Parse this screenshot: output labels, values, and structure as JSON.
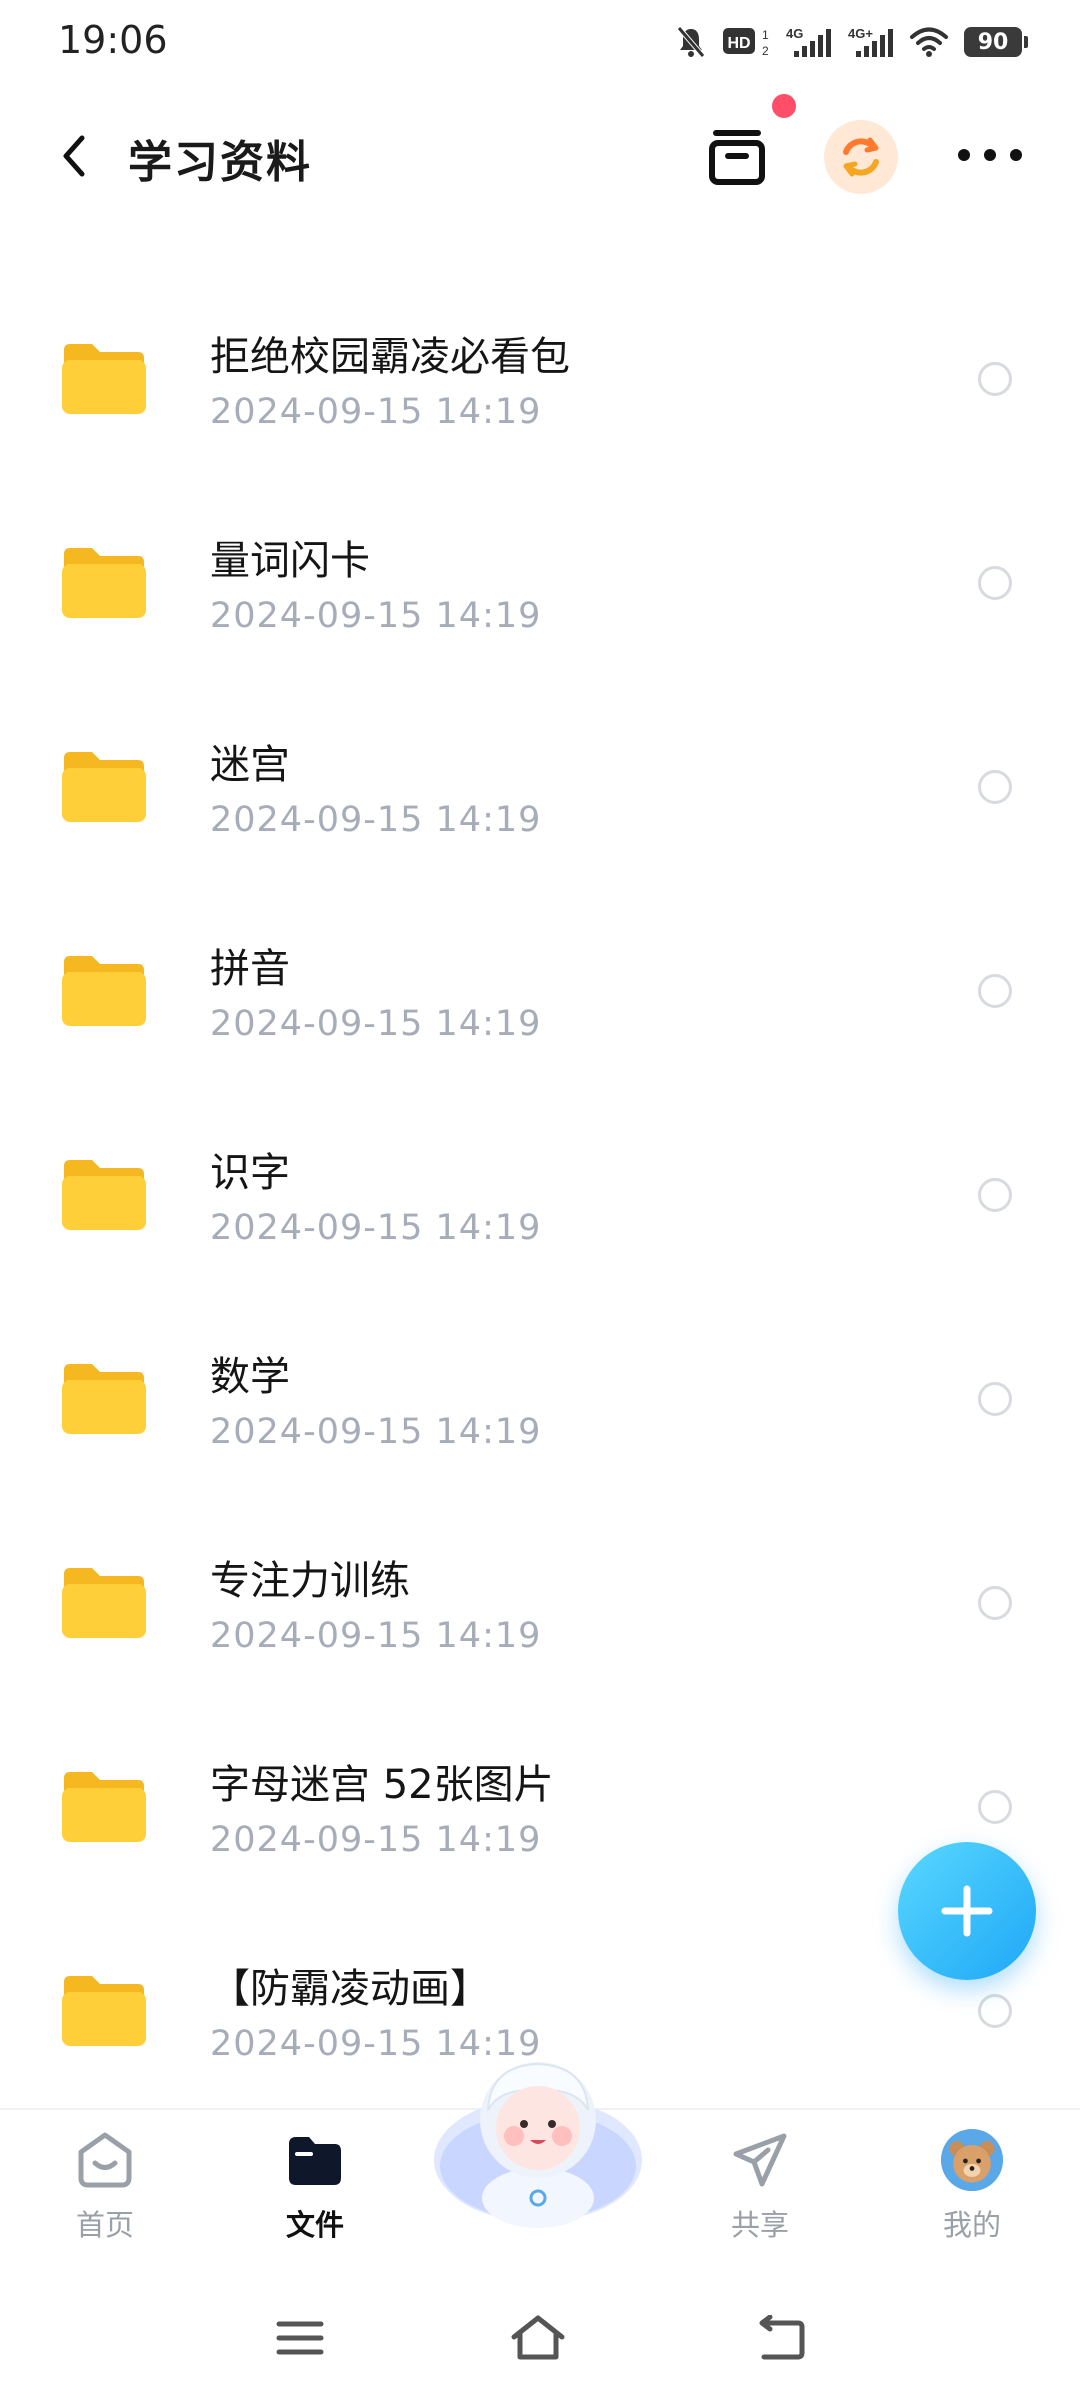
{
  "status_bar": {
    "time": "19:06",
    "battery": "90",
    "icons": [
      "mute-bell-icon",
      "hd-icon",
      "signal-4g-icon",
      "signal-4g-plus-icon",
      "wifi-icon",
      "battery-icon"
    ]
  },
  "header": {
    "title": "学习资料",
    "icons": [
      "back-icon",
      "archive-icon",
      "sync-icon",
      "more-icon"
    ],
    "notification_color": "#ff4d6a"
  },
  "files": [
    {
      "name": "拒绝校园霸凌必看包",
      "date": "2024-09-15  14:19"
    },
    {
      "name": "量词闪卡",
      "date": "2024-09-15  14:19"
    },
    {
      "name": "迷宫",
      "date": "2024-09-15  14:19"
    },
    {
      "name": "拼音",
      "date": "2024-09-15  14:19"
    },
    {
      "name": "识字",
      "date": "2024-09-15  14:19"
    },
    {
      "name": "数学",
      "date": "2024-09-15  14:19"
    },
    {
      "name": "专注力训练",
      "date": "2024-09-15  14:19"
    },
    {
      "name": "字母迷宫 52张图片",
      "date": "2024-09-15  14:19"
    },
    {
      "name": "【防霸凌动画】",
      "date": "2024-09-15  14:19"
    }
  ],
  "fab": {
    "icon": "plus-icon",
    "color": "#1ea7f6"
  },
  "bottom_nav": {
    "items": [
      {
        "label": "首页",
        "icon": "home-icon"
      },
      {
        "label": "文件",
        "icon": "folder-icon",
        "active": true
      },
      {
        "label": "共享",
        "icon": "send-icon"
      },
      {
        "label": "我的",
        "icon": "bear-avatar-icon"
      }
    ],
    "center": "mascot-icon"
  },
  "system_nav": [
    "menu-icon",
    "home-icon",
    "back-icon"
  ],
  "colors": {
    "folder": "#ffcc33",
    "accent": "#1ea7f6",
    "muted_text": "#a7adb8"
  }
}
